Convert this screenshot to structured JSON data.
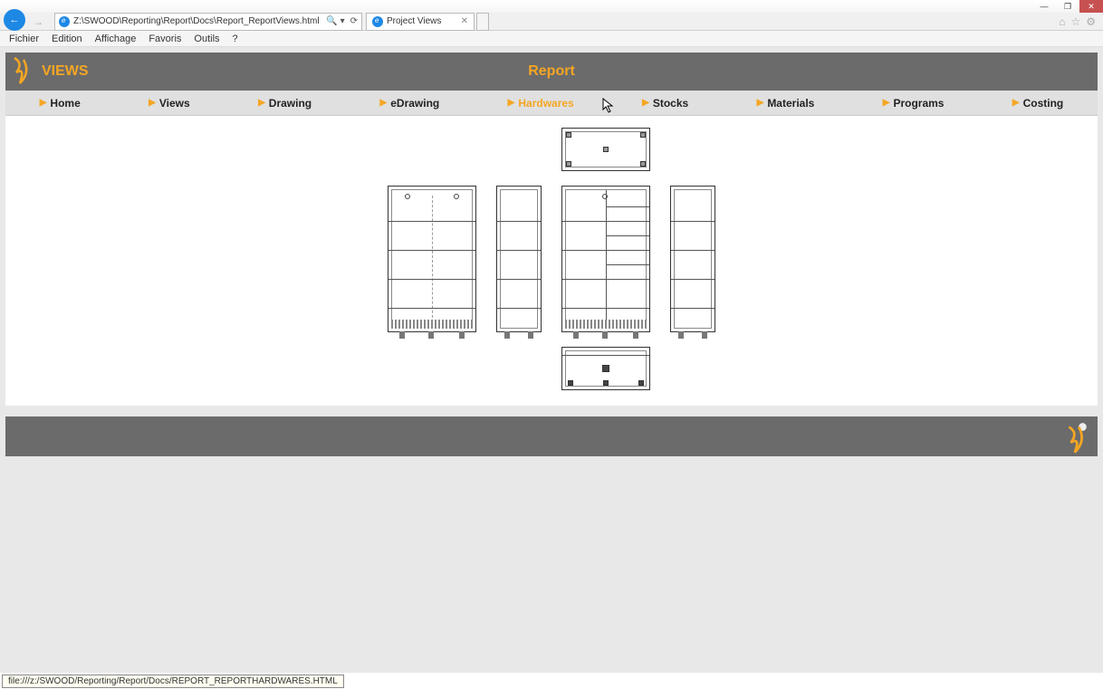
{
  "window": {
    "minimize": "—",
    "maximize": "❐",
    "close": "✕"
  },
  "browser": {
    "address": "Z:\\SWOOD\\Reporting\\Report\\Docs\\Report_ReportViews.html",
    "search_icon": "🔍",
    "refresh": "⟳",
    "tab_title": "Project Views",
    "tab_close": "✕",
    "home_icon": "⌂",
    "star_icon": "☆",
    "gear_icon": "⚙"
  },
  "menu": {
    "items": [
      "Fichier",
      "Edition",
      "Affichage",
      "Favoris",
      "Outils",
      "?"
    ]
  },
  "header": {
    "title": "VIEWS",
    "report": "Report"
  },
  "nav": {
    "items": [
      {
        "label": "Home",
        "active": false
      },
      {
        "label": "Views",
        "active": false
      },
      {
        "label": "Drawing",
        "active": false
      },
      {
        "label": "eDrawing",
        "active": false
      },
      {
        "label": "Hardwares",
        "active": true
      },
      {
        "label": "Stocks",
        "active": false
      },
      {
        "label": "Materials",
        "active": false
      },
      {
        "label": "Programs",
        "active": false
      },
      {
        "label": "Costing",
        "active": false
      }
    ],
    "triangle": "▶"
  },
  "status": {
    "url": "file:///z:/SWOOD/Reporting/Report/Docs/REPORT_REPORTHARDWARES.HTML"
  }
}
